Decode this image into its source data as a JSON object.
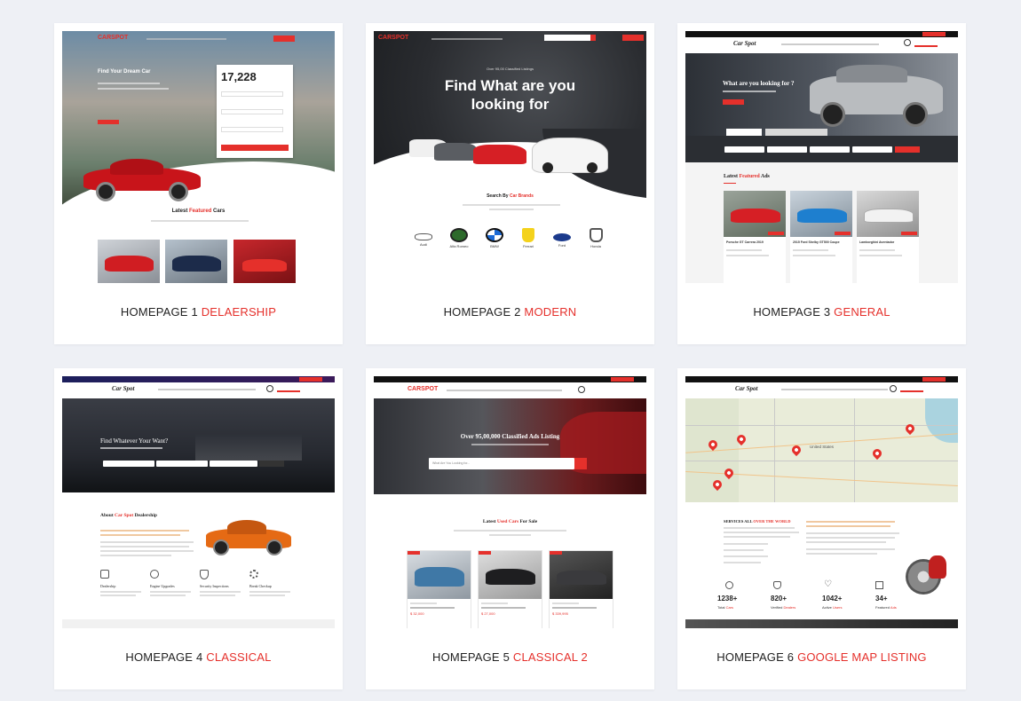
{
  "cards": [
    {
      "prefix": "HOMEPAGE 1 ",
      "accent": "DELAERSHIP",
      "preview": {
        "logo": "CARSPOT",
        "headline": "Find Your Dream Car",
        "counter": "17,228",
        "featured_prefix": "Latest ",
        "featured_accent": "Featured",
        "featured_suffix": " Cars"
      }
    },
    {
      "prefix": "HOMEPAGE 2 ",
      "accent": "MODERN",
      "preview": {
        "logo": "CARSPOT",
        "kicker": "Over 95,00 Classified Listings",
        "headline": "Find What are you looking for",
        "brands_title_prefix": "Search By ",
        "brands_title_accent": "Car Brands",
        "brands": [
          "Audi",
          "Alfa Romeo",
          "BMW",
          "Ferrari",
          "Ford",
          "Honda"
        ]
      }
    },
    {
      "prefix": "HOMEPAGE 3 ",
      "accent": "GENERAL",
      "preview": {
        "logo": "Car Spot",
        "headline": "What are you looking for ?",
        "featured_prefix": "Latest ",
        "featured_accent": "Featured",
        "featured_suffix": " Ads",
        "ads": [
          "Porsche GT Carrera 2019",
          "2015 Ford Shelby GT500 Coupe",
          "Lamborghini Aventador"
        ]
      }
    },
    {
      "prefix": "HOMEPAGE 4 ",
      "accent": "CLASSICAL",
      "preview": {
        "logo": "Car Spot",
        "headline": "Find Whatever Your Want?",
        "about_prefix": "About ",
        "about_accent": "Car Spot",
        "about_suffix": " Dealership",
        "services": [
          "Dealership",
          "Engine Upgrades",
          "Security Inspections",
          "Break Checkup"
        ]
      }
    },
    {
      "prefix": "HOMEPAGE 5 ",
      "accent": "CLASSICAL 2",
      "preview": {
        "logo": "CARSPOT",
        "headline": "Over 95,00,000 Classified Ads Listing",
        "search_placeholder": "What Are You Looking for...",
        "latest_prefix": "Latest ",
        "latest_accent": "Used Cars",
        "latest_suffix": " For Sale",
        "prices": [
          "$ 32,000",
          "$ 27,000",
          "$ 339,995"
        ]
      }
    },
    {
      "prefix": "HOMEPAGE 6 ",
      "accent": "GOOGLE MAP LISTING",
      "preview": {
        "logo": "Car Spot",
        "map_country": "United States",
        "services_prefix": "SERVICES ALL ",
        "services_accent": "OVER THE WORLD",
        "stats": [
          {
            "num": "1238+",
            "pre": "Total ",
            "accent": "Cars",
            "post": ""
          },
          {
            "num": "820+",
            "pre": "Verified ",
            "accent": "Dealers",
            "post": ""
          },
          {
            "num": "1042+",
            "pre": "Active ",
            "accent": "Users",
            "post": ""
          },
          {
            "num": "34+",
            "pre": "Featured ",
            "accent": "Ads",
            "post": ""
          }
        ]
      }
    }
  ],
  "colors": {
    "accent": "#e5302b",
    "background": "#eef0f5",
    "card": "#ffffff",
    "text": "#222222"
  }
}
